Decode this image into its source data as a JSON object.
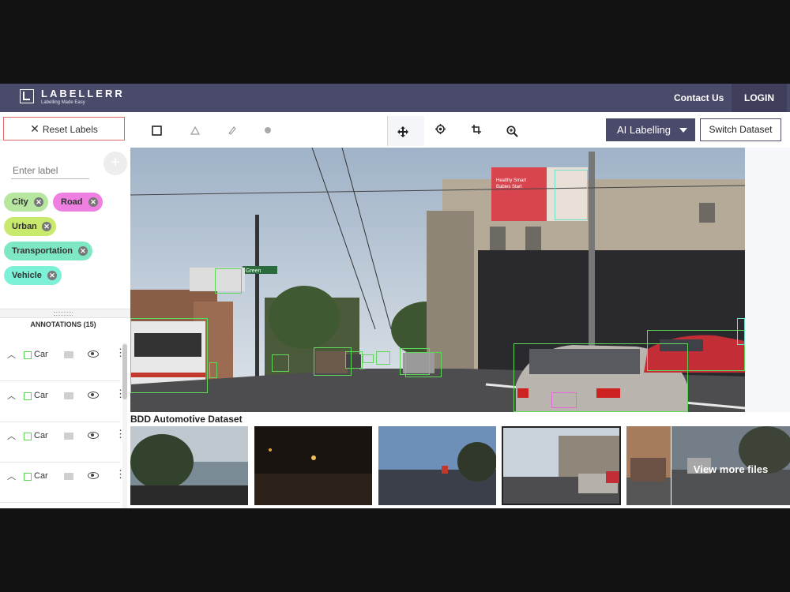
{
  "brand": {
    "name": "LABELLERR",
    "tagline": "Labelling Made Easy"
  },
  "nav": {
    "contact": "Contact Us",
    "login": "LOGIN"
  },
  "left_panel": {
    "reset_label": "Reset Labels",
    "input_placeholder": "Enter label",
    "labels": [
      {
        "text": "City",
        "color": "#b6e6a0"
      },
      {
        "text": "Road",
        "color": "#ef7fe0"
      },
      {
        "text": "Urban",
        "color": "#c8e96b"
      },
      {
        "text": "Transportation",
        "color": "#7de8c3"
      },
      {
        "text": "Vehicle",
        "color": "#7df0d8"
      }
    ],
    "annotations_header": "ANNOTATIONS (15)",
    "annotations": [
      {
        "class": "Car"
      },
      {
        "class": "Car"
      },
      {
        "class": "Car"
      },
      {
        "class": "Car"
      }
    ]
  },
  "toolbar": {
    "tools": [
      "rectangle-icon",
      "polygon-icon",
      "pen-icon",
      "point-icon",
      "move-icon",
      "target-icon",
      "crop-icon",
      "zoom-icon"
    ],
    "active_tool": "move-icon",
    "ai_labelling": "AI Labelling",
    "switch_dataset": "Switch Dataset"
  },
  "canvas": {
    "billboard_lines": [
      "Healthy Smart",
      "Babies Start"
    ],
    "street_sign": "Green",
    "annotation_count_shown": 15
  },
  "dataset": {
    "title": "BDD Automotive Dataset",
    "view_more": "View more files",
    "thumbnails": 6,
    "selected_index": 3
  }
}
